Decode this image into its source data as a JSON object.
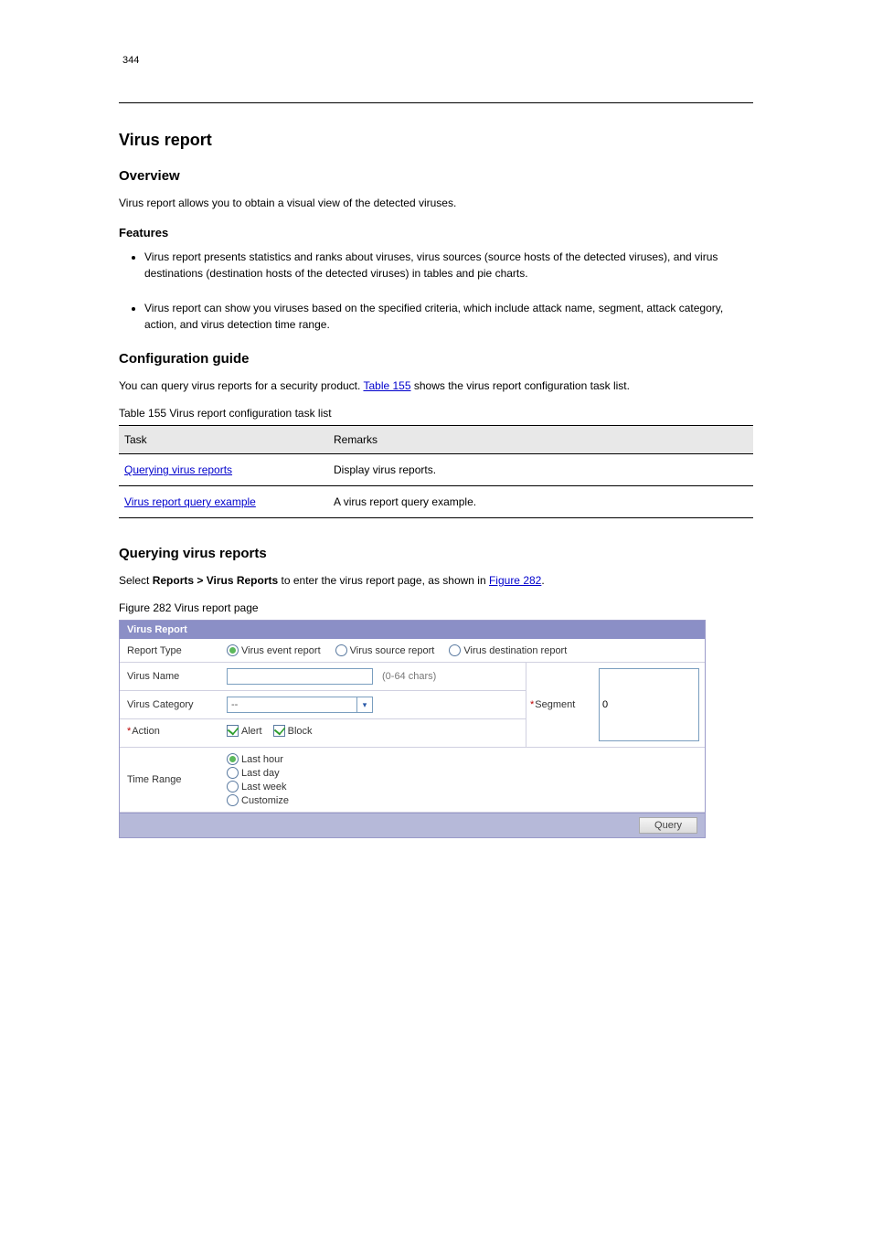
{
  "page_number_top": "344",
  "section": {
    "title": "Virus report",
    "overview_heading": "Overview",
    "overview_text": "Virus report allows you to obtain a visual view of the detected viruses.",
    "features_heading": "Features",
    "features": [
      "Virus report presents statistics and ranks about viruses, virus sources (source hosts of the detected viruses), and virus destinations (destination hosts of the detected viruses) in tables and pie charts.",
      "Virus report can show you viruses based on the specified criteria, which include attack name, segment, attack category, action, and virus detection time range."
    ],
    "config_guide_heading": "Configuration guide",
    "config_guide_text_prefix": "You can query virus reports for a security product. ",
    "config_guide_link": "Table 155",
    "config_guide_text_suffix": " shows the virus report configuration task list."
  },
  "table": {
    "caption": "Table 155 Virus report configuration task list",
    "headers": [
      "Task",
      "Remarks"
    ],
    "rows": [
      {
        "task": "Querying virus reports",
        "remarks": "Display virus reports."
      },
      {
        "task": "Virus report query example",
        "remarks": "A virus report query example."
      }
    ]
  },
  "subsection": {
    "heading": "Querying virus reports",
    "step_prefix": "Select ",
    "step_bold": "Reports > Virus Reports",
    "step_suffix": " to enter the virus report page, as shown in ",
    "step_link": "Figure 282",
    "step_period": "."
  },
  "figure": {
    "caption": "Figure 282 Virus report page"
  },
  "ui": {
    "title": "Virus Report",
    "report_type_label": "Report Type",
    "report_type_options": [
      {
        "label": "Virus event report",
        "checked": true
      },
      {
        "label": "Virus source report",
        "checked": false
      },
      {
        "label": "Virus destination report",
        "checked": false
      }
    ],
    "virus_name_label": "Virus Name",
    "virus_name_value": "",
    "virus_name_hint": "(0-64 chars)",
    "segment_label": "Segment",
    "segment_value": "0",
    "virus_category_label": "Virus Category",
    "virus_category_value": "--",
    "action_label": "Action",
    "action_options": [
      {
        "label": "Alert",
        "checked": true
      },
      {
        "label": "Block",
        "checked": true
      }
    ],
    "time_range_label": "Time Range",
    "time_range_options": [
      {
        "label": "Last hour",
        "checked": true
      },
      {
        "label": "Last day",
        "checked": false
      },
      {
        "label": "Last week",
        "checked": false
      },
      {
        "label": "Customize",
        "checked": false
      }
    ],
    "query_button": "Query"
  }
}
